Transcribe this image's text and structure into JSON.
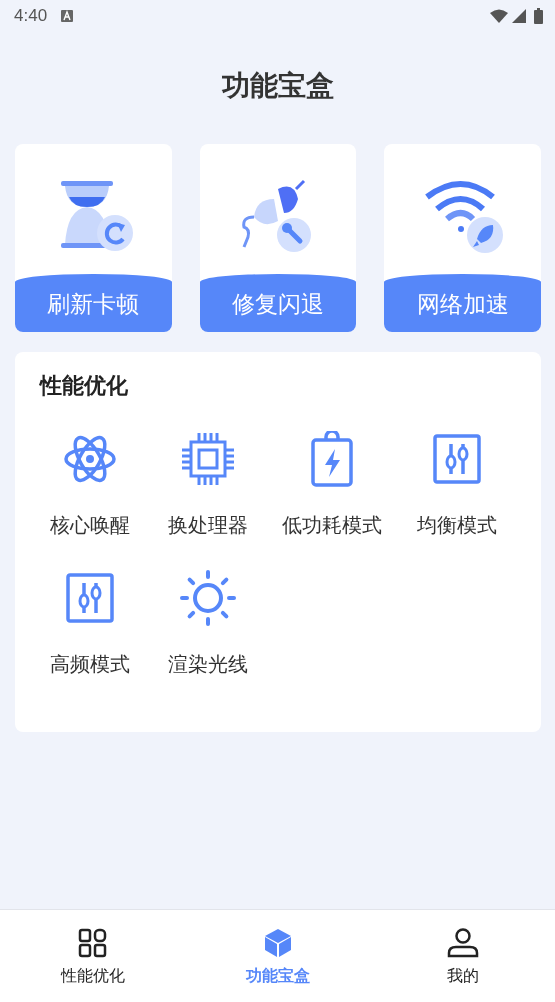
{
  "status_bar": {
    "time": "4:40"
  },
  "title": "功能宝盒",
  "tool_cards": [
    {
      "label": "刷新卡顿"
    },
    {
      "label": "修复闪退"
    },
    {
      "label": "网络加速"
    }
  ],
  "section": {
    "title": "性能优化",
    "items": [
      {
        "label": "核心唤醒"
      },
      {
        "label": "换处理器"
      },
      {
        "label": "低功耗模式"
      },
      {
        "label": "均衡模式"
      },
      {
        "label": "高频模式"
      },
      {
        "label": "渲染光线"
      }
    ]
  },
  "bottom_nav": [
    {
      "label": "性能优化",
      "selected": false
    },
    {
      "label": "功能宝盒",
      "selected": true
    },
    {
      "label": "我的",
      "selected": false
    }
  ]
}
